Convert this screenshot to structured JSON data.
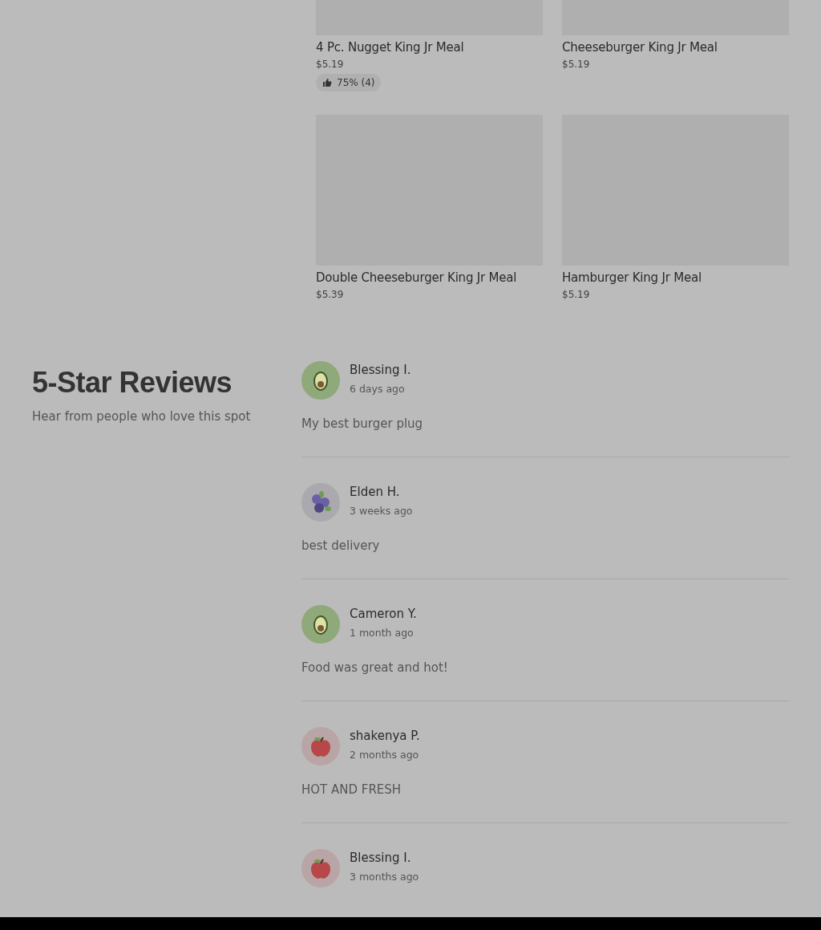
{
  "menu_items": [
    {
      "name": "4 Pc. Nugget King Jr Meal",
      "price": "$5.19",
      "rating": "75% (4)"
    },
    {
      "name": "Cheeseburger King Jr Meal",
      "price": "$5.19"
    },
    {
      "name": "Double Cheeseburger King Jr Meal",
      "price": "$5.39"
    },
    {
      "name": "Hamburger King Jr Meal",
      "price": "$5.19"
    }
  ],
  "reviews_section": {
    "title": "5-Star Reviews",
    "subtitle": "Hear from people who love this spot"
  },
  "reviews": [
    {
      "avatar": {
        "kind": "avocado"
      },
      "name": "Blessing I.",
      "time": "6 days ago",
      "text": "My best burger plug"
    },
    {
      "avatar": {
        "kind": "blueberry"
      },
      "name": "Elden H.",
      "time": "3 weeks ago",
      "text": "best delivery"
    },
    {
      "avatar": {
        "kind": "avocado"
      },
      "name": "Cameron Y.",
      "time": "1 month ago",
      "text": "Food was great and hot!"
    },
    {
      "avatar": {
        "kind": "apple"
      },
      "name": "shakenya P.",
      "time": "2 months ago",
      "text": "HOT AND FRESH"
    },
    {
      "avatar": {
        "kind": "apple"
      },
      "name": "Blessing I.",
      "time": "3 months ago"
    }
  ]
}
